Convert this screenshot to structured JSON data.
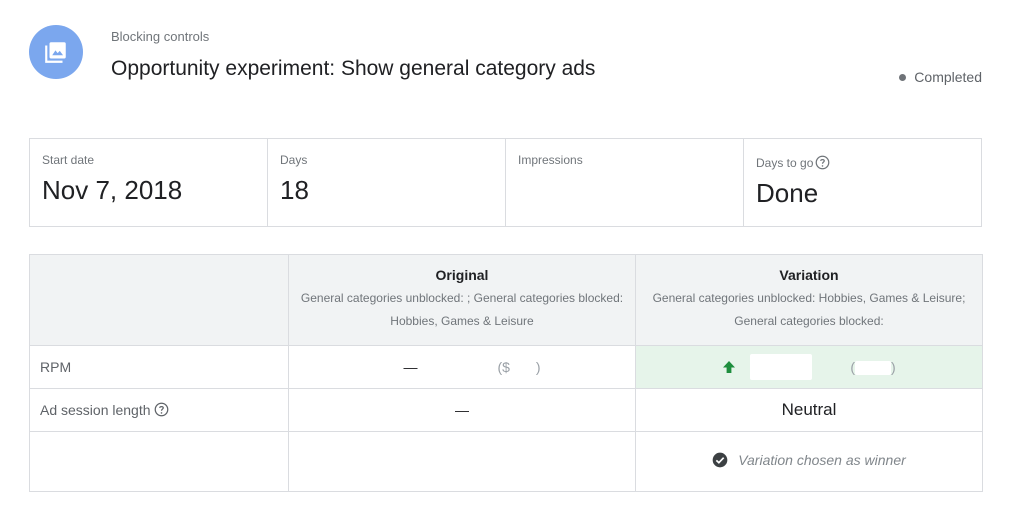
{
  "header": {
    "eyebrow": "Blocking controls",
    "title": "Opportunity experiment: Show general category ads",
    "status": "Completed",
    "avatar_icon": "image-gallery-icon",
    "avatar_color": "#7ba7ee"
  },
  "stats": [
    {
      "label": "Start date",
      "value": "Nov 7, 2018"
    },
    {
      "label": "Days",
      "value": "18"
    },
    {
      "label": "Impressions",
      "value": ""
    },
    {
      "label": "Days to go",
      "value": "Done",
      "icon": "help-icon"
    }
  ],
  "table": {
    "columns": [
      {
        "title": "",
        "description": ""
      },
      {
        "title": "Original",
        "description": "General categories unblocked: ; General categories blocked: Hobbies, Games & Leisure"
      },
      {
        "title": "Variation",
        "description": "General categories unblocked: Hobbies, Games & Leisure; General categories blocked:"
      }
    ],
    "rows": [
      {
        "label": "RPM",
        "original": "—",
        "original_paren_open": "($",
        "original_paren_close": ")",
        "variation_paren_open": "(",
        "variation_paren_close": ")",
        "variation_icon": "arrow-up-icon"
      },
      {
        "label": "Ad session length",
        "label_icon": "help-icon",
        "original": "—",
        "variation": "Neutral"
      },
      {
        "label": "",
        "original": "",
        "variation": "Variation chosen as winner",
        "variation_icon": "check-circle-icon"
      }
    ]
  },
  "colors": {
    "accent": "#7ba7ee",
    "winner_bg": "#e6f4ea",
    "up_arrow": "#1e8e3e"
  }
}
